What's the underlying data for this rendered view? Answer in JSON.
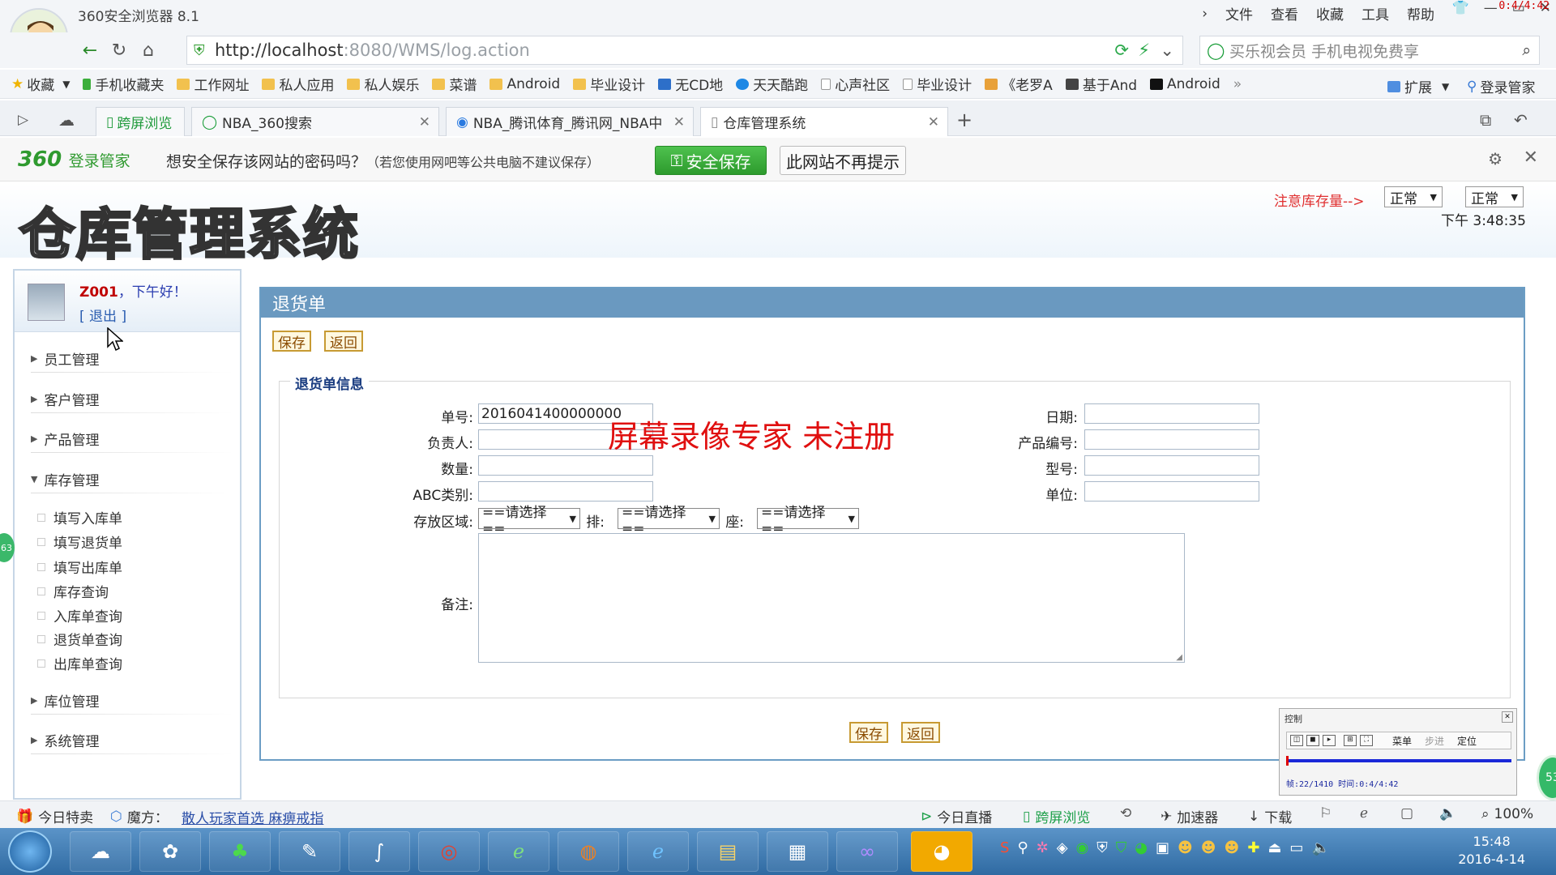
{
  "browser": {
    "title": "360安全浏览器 8.1",
    "menu": [
      "文件",
      "查看",
      "收藏",
      "工具",
      "帮助"
    ],
    "rec_time": "0:4/4:42",
    "url_host": "http://localhost",
    "url_rest": ":8080/WMS/log.action",
    "search_placeholder": "买乐视会员 手机电视免费享",
    "bookmarks": [
      "收藏",
      "手机收藏夹",
      "工作网址",
      "私人应用",
      "私人娱乐",
      "菜谱",
      "Android",
      "毕业设计",
      "无CD地",
      "天天酷跑",
      "心声社区",
      "毕业设计",
      "《老罗A",
      "基于And",
      "Android"
    ],
    "ext_label": "扩展",
    "login_mgr": "登录管家",
    "tabs": [
      "跨屏浏览",
      "NBA_360搜索",
      "NBA_腾讯体育_腾讯网_NBA中",
      "仓库管理系统"
    ]
  },
  "loginbar": {
    "brand": "360",
    "brand_sub": "登录管家",
    "question": "想安全保存该网站的密码吗？",
    "question_note": "（若您使用网吧等公共电脑不建议保存）",
    "safe_save": "安全保存",
    "no_prompt": "此网站不再提示"
  },
  "header": {
    "app_title": "仓库管理系统",
    "stock_warn": "注意库存量-->",
    "select1": "正常",
    "select2": "正常",
    "time": "下午 3:48:35"
  },
  "sidebar": {
    "user_id": "Z001",
    "greeting": "，下午好！",
    "logout": "[ 退出 ]",
    "menu": {
      "emp": "员工管理",
      "cust": "客户管理",
      "prod": "产品管理",
      "stock": "库存管理",
      "loc": "库位管理",
      "sys": "系统管理"
    },
    "sub": [
      "填写入库单",
      "填写退货单",
      "填写出库单",
      "库存查询",
      "入库单查询",
      "退货单查询",
      "出库单查询"
    ]
  },
  "form": {
    "panel_title": "退货单",
    "save": "保存",
    "back": "返回",
    "legend": "退货单信息",
    "labels": {
      "order_no": "单号:",
      "manager": "负责人:",
      "qty": "数量:",
      "abc": "ABC类别:",
      "area": "存放区域:",
      "row": "排:",
      "seat": "座:",
      "remark": "备注:",
      "date": "日期:",
      "prod_no": "产品编号:",
      "model": "型号:",
      "unit": "单位:"
    },
    "values": {
      "order_no": "2016041400000000",
      "manager": "",
      "qty": "",
      "abc": "",
      "date": "",
      "prod_no": "",
      "model": "",
      "unit": "",
      "area": "==请选择==",
      "row": "==请选择==",
      "seat": "==请选择=="
    }
  },
  "watermark": "屏幕录像专家  未注册",
  "ctrl_panel": {
    "title": "控制",
    "menu": "菜单",
    "step": "步进",
    "locate": "定位",
    "frame_info": "帧:22/1410 时间:0:4/4:42"
  },
  "statusbar": {
    "deal": "今日特卖",
    "cube": "魔方：",
    "cube_link": "散人玩家首选 麻痹戒指",
    "live": "今日直播",
    "cross": "跨屏浏览",
    "accel": "加速器",
    "download": "下载",
    "zoom": "100%"
  },
  "taskbar": {
    "time": "15:48",
    "date": "2016-4-14"
  },
  "side_badges": [
    "63",
    "53"
  ]
}
